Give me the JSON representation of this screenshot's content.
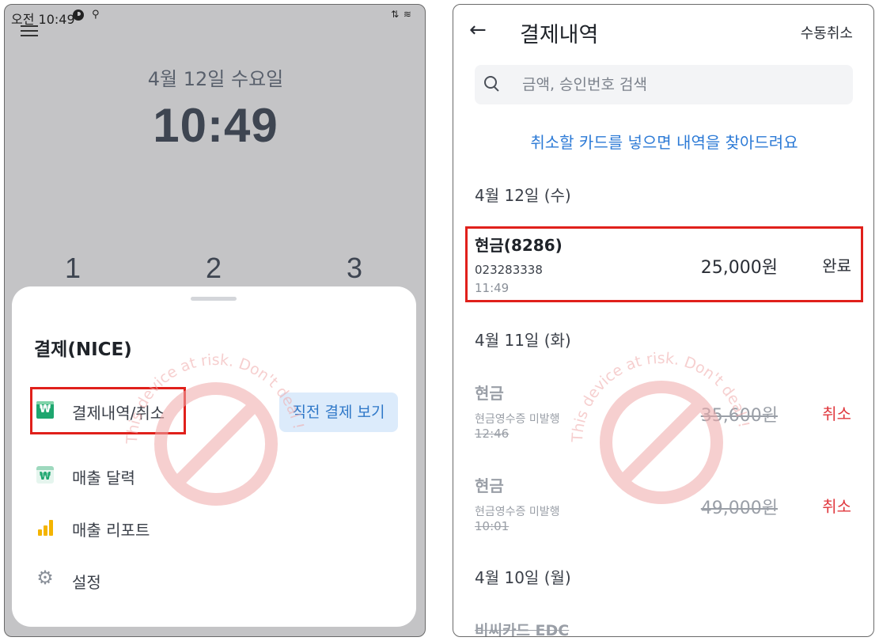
{
  "left": {
    "status_bar": {
      "time": "오전 10:49",
      "icon_notify": "notification-icon",
      "icon_location": "location-icon",
      "icon_right": "wifi-signal-icon"
    },
    "lock_screen": {
      "date": "4월 12일 수요일",
      "time": "10:49"
    },
    "numpad": [
      "1",
      "2",
      "3"
    ],
    "sheet": {
      "title": "결제(NICE)",
      "items": [
        {
          "label": "결제내역/취소",
          "icon": "won-card-icon"
        },
        {
          "label": "매출 달력",
          "icon": "won-calendar-icon"
        },
        {
          "label": "매출 리포트",
          "icon": "bar-chart-icon"
        },
        {
          "label": "설정",
          "icon": "gear-icon"
        }
      ],
      "quick_button": "직전 결제 보기"
    }
  },
  "right": {
    "header": {
      "title": "결제내역",
      "action": "수동취소",
      "back_icon": "arrow-left-icon"
    },
    "search": {
      "placeholder": "금액, 승인번호 검색",
      "value": ""
    },
    "hint": "취소할 카드를 넣으면 내역을 찾아드려요",
    "groups": [
      {
        "date": "4월 12일 (수)",
        "transactions": [
          {
            "name": "현금(8286)",
            "sub": "023283338",
            "time": "11:49",
            "amount": "25,000원",
            "status": "완료",
            "cancelled": false
          }
        ]
      },
      {
        "date": "4월 11일 (화)",
        "transactions": [
          {
            "name": "현금",
            "sub": "현금영수증 미발행",
            "time": "12:46",
            "amount": "35,600원",
            "status": "취소",
            "cancelled": true
          },
          {
            "name": "현금",
            "sub": "현금영수증 미발행",
            "time": "10:01",
            "amount": "49,000원",
            "status": "취소",
            "cancelled": true
          }
        ]
      },
      {
        "date": "4월 10일 (월)",
        "transactions": [
          {
            "name": "비씨카드 EDC"
          }
        ]
      }
    ]
  },
  "watermark_text": "This device at risk. Don't deal !",
  "colors": {
    "accent_blue": "#2c7ad6",
    "highlight_red": "#e0201b",
    "cancel_red": "#e0383e",
    "won_green": "#1ea66f",
    "report_yellow": "#f4b400"
  }
}
